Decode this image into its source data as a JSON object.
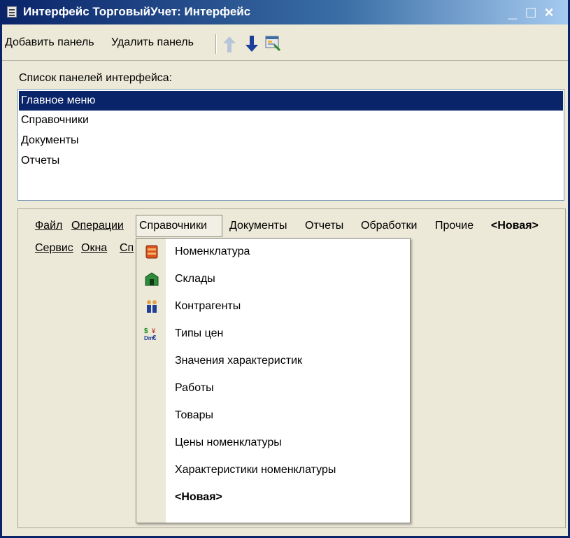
{
  "window": {
    "title": "Интерфейс ТорговыйУчет: Интерфейс",
    "controls": [
      "_",
      "□",
      "×"
    ]
  },
  "toolbar": {
    "add_panel": "Добавить панель",
    "remove_panel": "Удалить панель",
    "icons": [
      "arrow-up-icon",
      "arrow-down-icon",
      "preview-icon"
    ]
  },
  "panels_list": {
    "label": "Список панелей интерфейса:",
    "items": [
      "Главное меню",
      "Справочники",
      "Документы",
      "Отчеты"
    ],
    "selected": "Главное меню"
  },
  "menu_bar": {
    "row1": [
      "Файл",
      "Операции",
      "Справочники",
      "Документы",
      "Отчеты",
      "Обработки",
      "Прочие",
      "<Новая>"
    ],
    "row2": [
      "Сервис",
      "Окна",
      "Сп"
    ]
  },
  "dropdown": {
    "items": [
      {
        "label": "Номенклатура",
        "icon": "nomenclature-icon"
      },
      {
        "label": "Склады",
        "icon": "warehouse-icon"
      },
      {
        "label": "Контрагенты",
        "icon": "contractors-icon"
      },
      {
        "label": "Типы цен",
        "icon": "currency-icon"
      },
      {
        "label": "Значения характеристик",
        "icon": ""
      },
      {
        "label": "Работы",
        "icon": ""
      },
      {
        "label": "Товары",
        "icon": ""
      },
      {
        "label": "Цены номенклатуры",
        "icon": ""
      },
      {
        "label": "Характеристики номенклатуры",
        "icon": ""
      },
      {
        "label": "<Новая>",
        "icon": ""
      }
    ]
  },
  "colors": {
    "selection": "#0A246A",
    "titlebar_start": "#0A246A",
    "titlebar_end": "#A6CAF0",
    "window_bg": "#ECE9D8"
  }
}
